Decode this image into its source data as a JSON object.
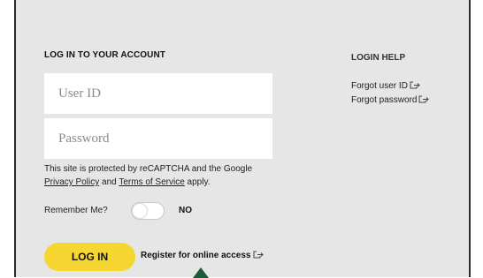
{
  "login": {
    "heading": "LOG IN TO YOUR ACCOUNT",
    "user_id_placeholder": "User ID",
    "password_placeholder": "Password",
    "recaptcha_prefix": "This site is protected by reCAPTCHA and the Google ",
    "privacy_policy": "Privacy Policy",
    "recaptcha_and": " and ",
    "terms_of_service": "Terms of Service",
    "recaptcha_suffix": " apply.",
    "remember_label": "Remember Me?",
    "remember_state": "NO",
    "remember_on": false,
    "login_button": "LOG IN",
    "register_link": "Register for online access"
  },
  "help": {
    "heading": "LOGIN HELP",
    "forgot_user_id": "Forgot user ID",
    "forgot_password": "Forgot password"
  },
  "icons": {
    "external": "external-link-icon",
    "pointer": "arrow-up-icon"
  },
  "colors": {
    "panel_bg": "#e6e6e6",
    "button_yellow": "#f6d731",
    "arrow_green": "#1c5a3a"
  }
}
